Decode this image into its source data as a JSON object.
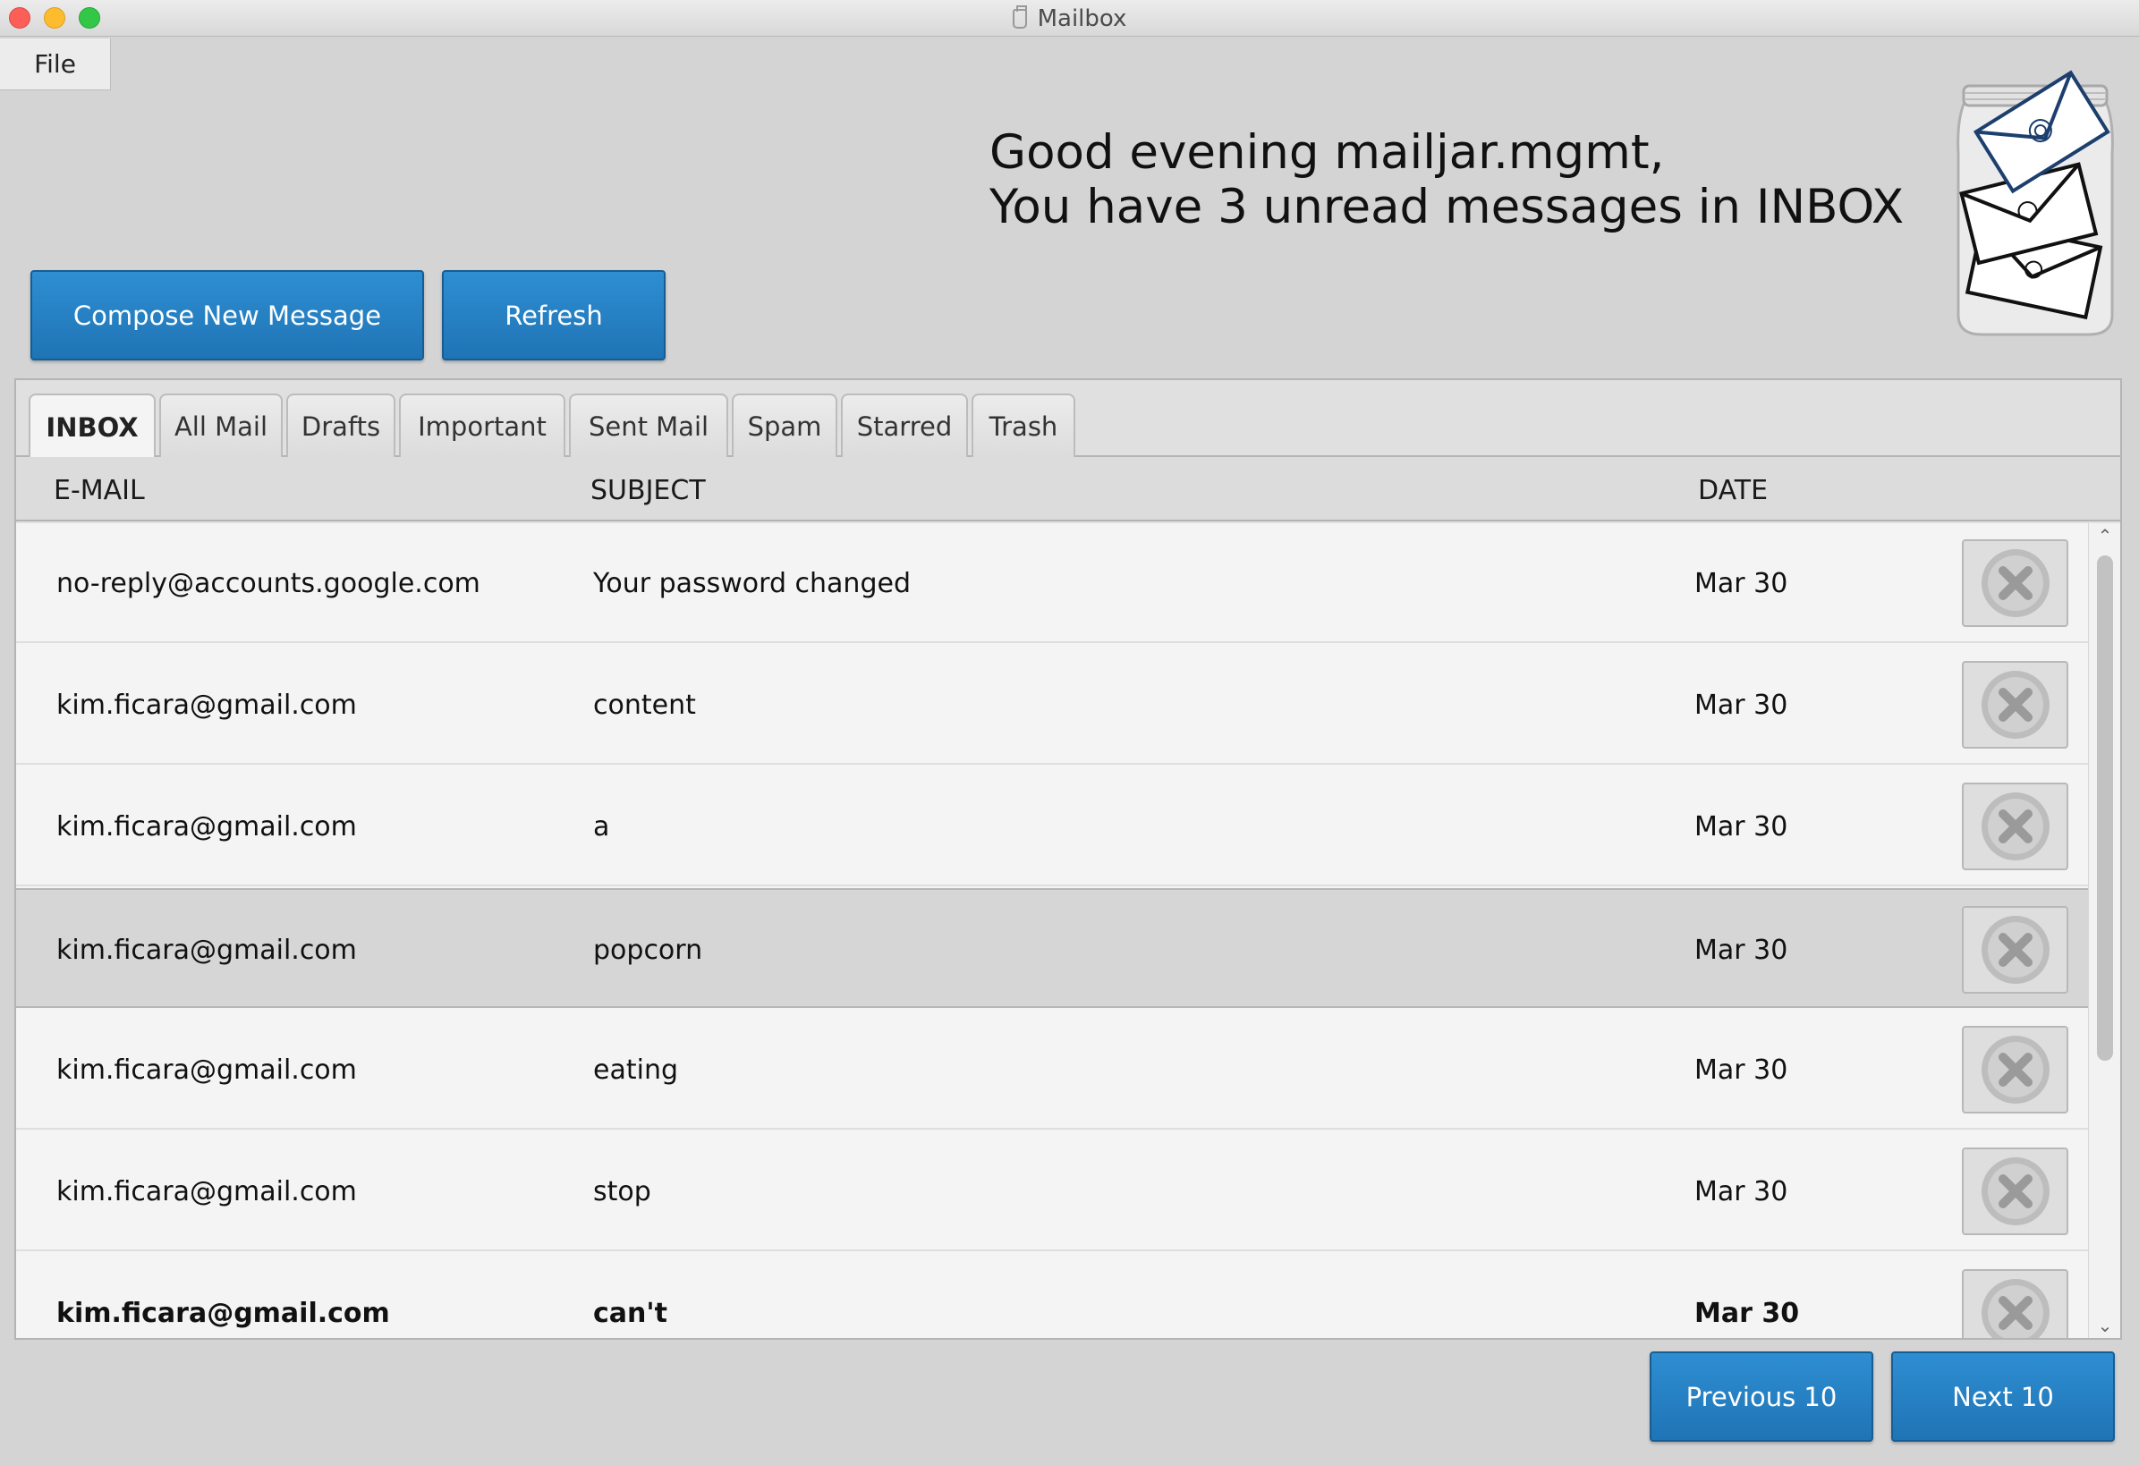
{
  "window": {
    "title": "Mailbox"
  },
  "menu": {
    "file_label": "File"
  },
  "greeting": {
    "line1": "Good evening mailjar.mgmt,",
    "line2": "You have 3 unread messages in INBOX"
  },
  "toolbar": {
    "compose_label": "Compose New Message",
    "refresh_label": "Refresh"
  },
  "tabs": [
    {
      "label": "INBOX",
      "active": true
    },
    {
      "label": "All Mail"
    },
    {
      "label": "Drafts"
    },
    {
      "label": "Important"
    },
    {
      "label": "Sent Mail"
    },
    {
      "label": "Spam"
    },
    {
      "label": "Starred"
    },
    {
      "label": "Trash"
    }
  ],
  "table": {
    "columns": {
      "email": "E-MAIL",
      "subject": "SUBJECT",
      "date": "DATE"
    },
    "rows": [
      {
        "email": "no-reply@accounts.google.com",
        "subject": "Your password changed",
        "date": "Mar 30",
        "unread": false,
        "selected": false
      },
      {
        "email": "kim.ficara@gmail.com",
        "subject": "content",
        "date": "Mar 30",
        "unread": false,
        "selected": false
      },
      {
        "email": "kim.ficara@gmail.com",
        "subject": "a",
        "date": "Mar 30",
        "unread": false,
        "selected": false
      },
      {
        "email": "kim.ficara@gmail.com",
        "subject": "popcorn",
        "date": "Mar 30",
        "unread": false,
        "selected": true
      },
      {
        "email": "kim.ficara@gmail.com",
        "subject": "eating",
        "date": "Mar 30",
        "unread": false,
        "selected": false
      },
      {
        "email": "kim.ficara@gmail.com",
        "subject": "stop",
        "date": "Mar 30",
        "unread": false,
        "selected": false
      },
      {
        "email": "kim.ficara@gmail.com",
        "subject": "can't",
        "date": "Mar 30",
        "unread": true,
        "selected": false
      }
    ]
  },
  "pagination": {
    "previous_label": "Previous 10",
    "next_label": "Next 10"
  },
  "colors": {
    "accent": "#2784c8",
    "window_bg": "#d4d4d4"
  }
}
